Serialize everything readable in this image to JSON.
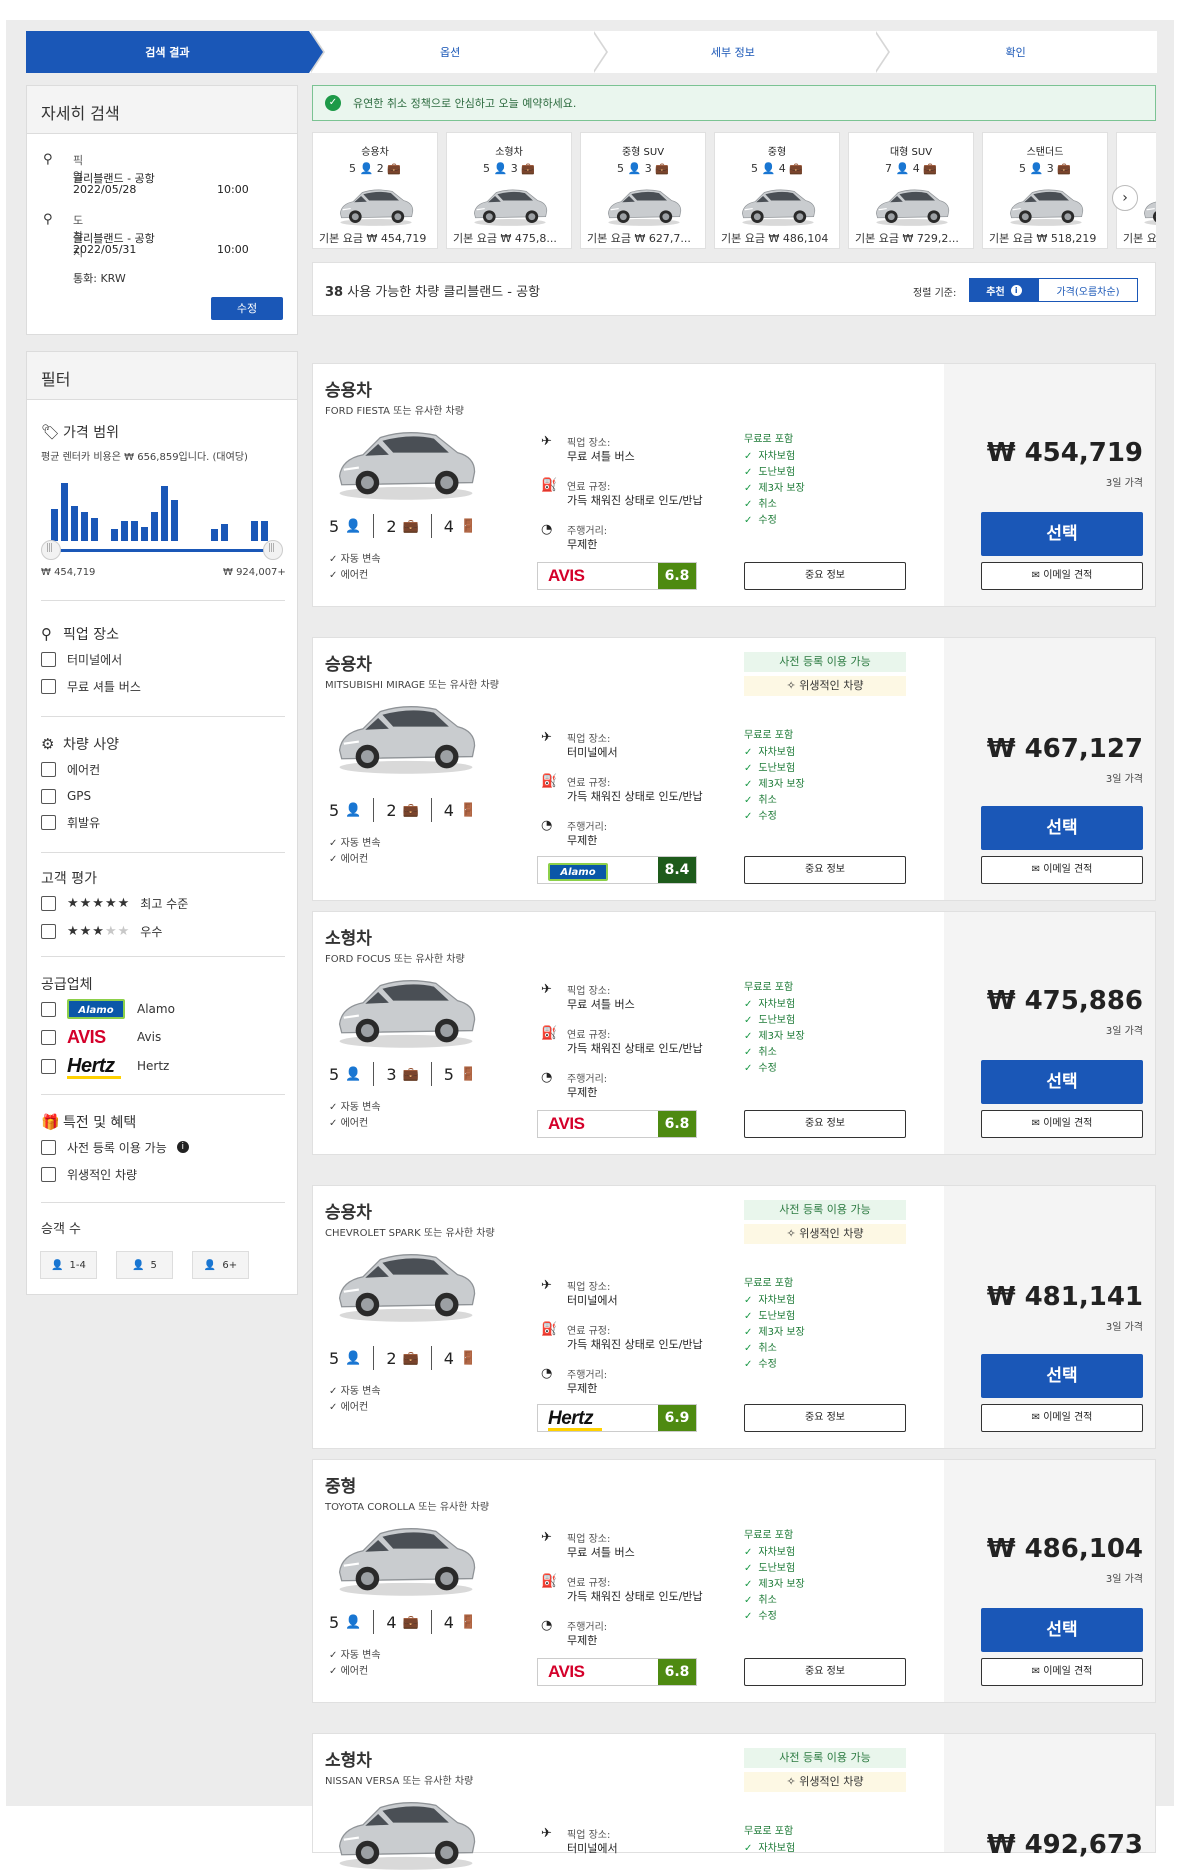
{
  "steps": [
    "검색 결과",
    "옵션",
    "세부 정보",
    "확인"
  ],
  "search": {
    "title": "자세히 검색",
    "pickup_label": "픽업",
    "pickup_location": "클리블랜드 - 공항",
    "pickup_date": "2022/05/28",
    "pickup_time": "10:00",
    "dropoff_label": "도착지",
    "dropoff_location": "클리블랜드 - 공항",
    "dropoff_date": "2022/05/31",
    "dropoff_time": "10:00",
    "currency": "통화: KRW",
    "edit_button": "수정"
  },
  "filter": {
    "title": "필터",
    "price_title": "가격 범위",
    "price_note": "평균 렌터카 비용은 ₩ 656,859입니다. (대여당)",
    "price_min": "₩ 454,719",
    "price_max": "₩ 924,007+",
    "histogram": [
      0.55,
      1.0,
      0.6,
      0.5,
      0.4,
      0.0,
      0.2,
      0.35,
      0.35,
      0.25,
      0.5,
      0.95,
      0.7,
      0.0,
      0.0,
      0.0,
      0.2,
      0.3,
      0.0,
      0.0,
      0.35,
      0.35
    ],
    "pickup_title": "픽업 장소",
    "pickup_options": [
      "터미널에서",
      "무료 셔틀 버스"
    ],
    "spec_title": "차량 사양",
    "spec_options": [
      "에어컨",
      "GPS",
      "휘발유"
    ],
    "rating_title": "고객 평가",
    "rating_options": [
      {
        "stars_on": "★★★★★",
        "stars_off": "",
        "label": "최고 수준"
      },
      {
        "stars_on": "★★★",
        "stars_off": "★★",
        "label": "우수"
      }
    ],
    "supplier_title": "공급업체",
    "suppliers": [
      {
        "logo": "Alamo",
        "name": "Alamo"
      },
      {
        "logo": "AVIS",
        "name": "Avis"
      },
      {
        "logo": "Hertz",
        "name": "Hertz"
      }
    ],
    "deals_title": "특전 및 혜택",
    "deals_options": [
      "사전 등록 이용 가능",
      "위생적인 차량"
    ],
    "pax_title": "승객 수",
    "pax_options": [
      "1-4",
      "5",
      "6+"
    ]
  },
  "banner": "유연한 취소 정책으로 안심하고 오늘 예약하세요.",
  "categories": [
    {
      "name": "승용차",
      "pax": "5",
      "bags": "2",
      "price": "기본 요금 ₩ 454,719"
    },
    {
      "name": "소형차",
      "pax": "5",
      "bags": "3",
      "price": "기본 요금 ₩ 475,8..."
    },
    {
      "name": "중형 SUV",
      "pax": "5",
      "bags": "3",
      "price": "기본 요금 ₩ 627,7..."
    },
    {
      "name": "중형",
      "pax": "5",
      "bags": "4",
      "price": "기본 요금 ₩ 486,104"
    },
    {
      "name": "대형 SUV",
      "pax": "7",
      "bags": "4",
      "price": "기본 요금 ₩ 729,2..."
    },
    {
      "name": "스탠더드",
      "pax": "5",
      "bags": "3",
      "price": "기본 요금 ₩ 518,219"
    },
    {
      "name": "",
      "pax": "5",
      "bags": "",
      "price": "기본 요"
    }
  ],
  "results": {
    "count": "38",
    "text": "사용 가능한 차량 클리블랜드 - 공항",
    "sort_label": "정렬 기준:",
    "sort_recommended": "추천",
    "sort_price": "가격(오름차순)"
  },
  "labels": {
    "pickup": "픽업 장소:",
    "fuel": "연료 규정:",
    "fuel_value": "가득 채워진 상태로 인도/반납",
    "mileage": "주행거리:",
    "mileage_value": "무제한",
    "included": "무료로 포함",
    "inclusions": [
      "자차보험",
      "도난보험",
      "제3자 보장",
      "취소",
      "수정"
    ],
    "features": [
      "자동 변속",
      "에어컨"
    ],
    "important_info": "중요 정보",
    "select": "선택",
    "email_quote": "이메일 견적",
    "days": "3일 가격",
    "badge_precheck": "사전 등록 이용 가능",
    "badge_clean": "위생적인 차량"
  },
  "listings": [
    {
      "category": "승용차",
      "model": "FORD FIESTA 또는 유사한 차량",
      "pax": "5",
      "bags": "2",
      "doors": "4",
      "pickup_value": "무료 셔틀 버스",
      "vendor": "AVIS",
      "score": "6.8",
      "price": "₩ 454,719",
      "badges": false
    },
    {
      "category": "승용차",
      "model": "MITSUBISHI MIRAGE 또는 유사한 차량",
      "pax": "5",
      "bags": "2",
      "doors": "4",
      "pickup_value": "터미널에서",
      "vendor": "Alamo",
      "score": "8.4",
      "price": "₩ 467,127",
      "badges": true
    },
    {
      "category": "소형차",
      "model": "FORD FOCUS 또는 유사한 차량",
      "pax": "5",
      "bags": "3",
      "doors": "5",
      "pickup_value": "무료 셔틀 버스",
      "vendor": "AVIS",
      "score": "6.8",
      "price": "₩ 475,886",
      "badges": false
    },
    {
      "category": "승용차",
      "model": "CHEVROLET SPARK 또는 유사한 차량",
      "pax": "5",
      "bags": "2",
      "doors": "4",
      "pickup_value": "터미널에서",
      "vendor": "Hertz",
      "score": "6.9",
      "price": "₩ 481,141",
      "badges": true
    },
    {
      "category": "중형",
      "model": "TOYOTA COROLLA 또는 유사한 차량",
      "pax": "5",
      "bags": "4",
      "doors": "4",
      "pickup_value": "무료 셔틀 버스",
      "vendor": "AVIS",
      "score": "6.8",
      "price": "₩ 486,104",
      "badges": false
    },
    {
      "category": "소형차",
      "model": "NISSAN VERSA 또는 유사한 차량",
      "pax": "",
      "bags": "",
      "doors": "",
      "pickup_value": "터미널에서",
      "vendor": "",
      "score": "",
      "price": "₩ 492,673",
      "badges": true
    }
  ],
  "colors": {
    "brand": "#1a57b7",
    "score": "#4e8a11",
    "included": "#1c7a36"
  }
}
